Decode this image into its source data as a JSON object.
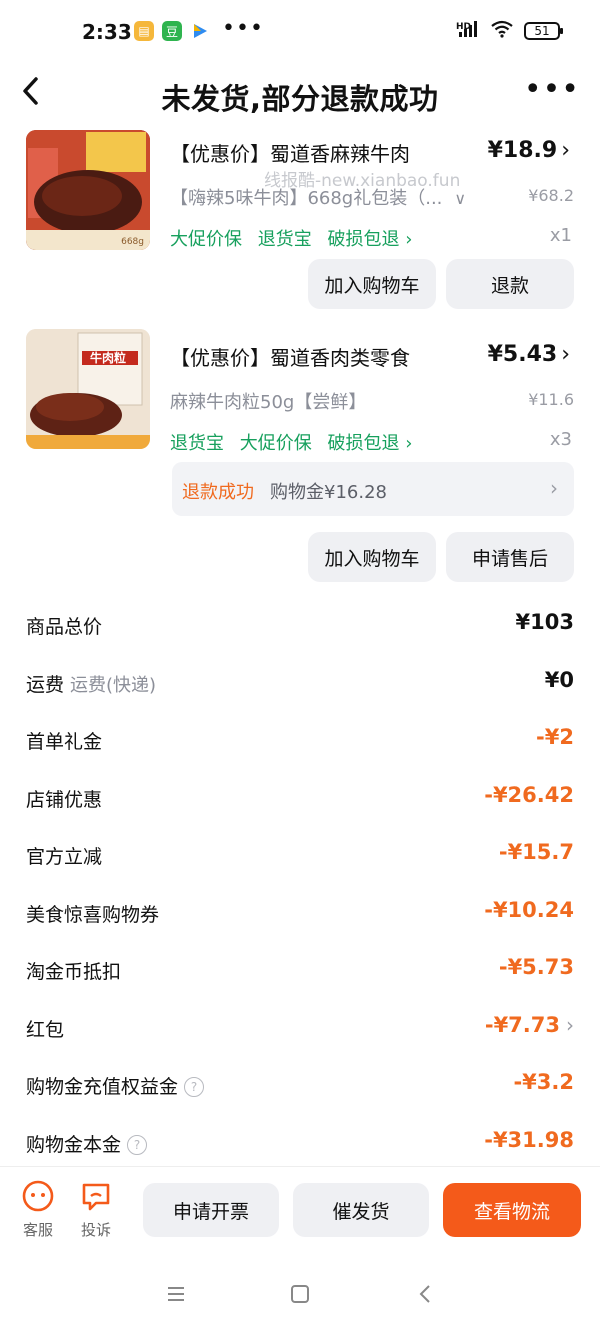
{
  "status_bar": {
    "time": "2:33",
    "app_icons": [
      "notes-icon",
      "douban-icon",
      "play-icon"
    ],
    "more": "•••",
    "network": "HD",
    "battery": "51"
  },
  "header": {
    "title": "未发货,部分退款成功",
    "back": "‹",
    "more": "•••"
  },
  "watermark": "线报酷-new.xianbao.fun",
  "products": [
    {
      "title": "【优惠价】蜀道香麻辣牛肉",
      "price": "¥18.9",
      "spec": "【嗨辣5味牛肉】668g礼包装（...",
      "original_price": "¥68.2",
      "tags": [
        "大促价保",
        "退货宝",
        "破损包退 ›"
      ],
      "qty": "x1",
      "image_caption": "668g",
      "buttons": [
        "加入购物车",
        "退款"
      ]
    },
    {
      "title": "【优惠价】蜀道香肉类零食",
      "price": "¥5.43",
      "spec": "麻辣牛肉粒50g【尝鲜】",
      "original_price": "¥11.6",
      "tags": [
        "退货宝",
        "大促价保",
        "破损包退 ›"
      ],
      "qty": "x3",
      "image_caption": "牛肉粒",
      "refund": {
        "status": "退款成功",
        "amount": "购物金¥16.28"
      },
      "buttons": [
        "加入购物车",
        "申请售后"
      ]
    }
  ],
  "summary": [
    {
      "label": "商品总价",
      "value": "¥103",
      "negative": false
    },
    {
      "label": "运费",
      "sub": "运费(快递)",
      "value": "¥0",
      "negative": false
    },
    {
      "label": "首单礼金",
      "value": "-¥2",
      "negative": true
    },
    {
      "label": "店铺优惠",
      "value": "-¥26.42",
      "negative": true
    },
    {
      "label": "官方立减",
      "value": "-¥15.7",
      "negative": true
    },
    {
      "label": "美食惊喜购物券",
      "value": "-¥10.24",
      "negative": true
    },
    {
      "label": "淘金币抵扣",
      "value": "-¥5.73",
      "negative": true
    },
    {
      "label": "红包",
      "value": "-¥7.73",
      "negative": true,
      "chevron": true
    },
    {
      "label": "购物金充值权益金",
      "value": "-¥3.2",
      "negative": true,
      "help": true
    },
    {
      "label": "购物金本金",
      "value": "-¥31.98",
      "negative": true,
      "help": true
    }
  ],
  "bottom_bar": {
    "service": "客服",
    "complaint": "投诉",
    "invoice": "申请开票",
    "urge": "催发货",
    "logistics": "查看物流"
  },
  "colors": {
    "accent": "#f45a1a",
    "negative": "#f06a1f",
    "tag_green": "#17a05d"
  }
}
